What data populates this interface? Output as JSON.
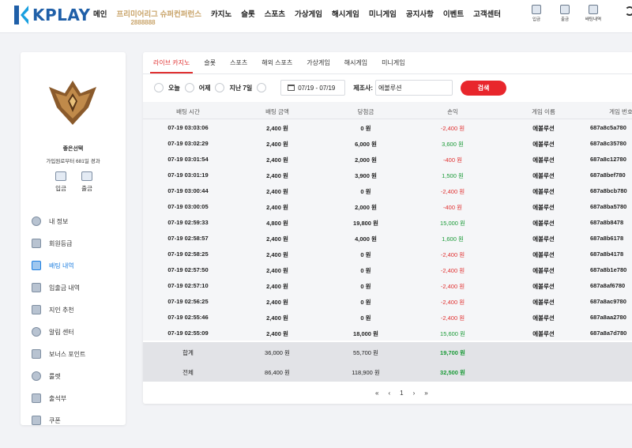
{
  "header": {
    "logo_text": "KPLAY",
    "nav": [
      "메인",
      "프리미어리그 슈퍼컨퍼런스",
      "카지노",
      "슬롯",
      "스포츠",
      "가상게임",
      "해시게임",
      "미니게임",
      "공지사항",
      "이벤트",
      "고객센터"
    ],
    "promo_sub": "2888888",
    "icons": [
      {
        "label": "입금",
        "icon": "deposit-icon"
      },
      {
        "label": "출금",
        "icon": "withdraw-icon"
      },
      {
        "label": "배팅내역",
        "icon": "history-icon"
      }
    ]
  },
  "sidebar": {
    "user_name": "좋은선택",
    "user_sub": "가입원로부터 681일 경과",
    "btn_deposit": "입금",
    "btn_withdraw": "출금",
    "menu": [
      {
        "label": "내 정보",
        "icon": "user-icon",
        "active": false
      },
      {
        "label": "회원등급",
        "icon": "rank-icon",
        "active": false
      },
      {
        "label": "배팅 내역",
        "icon": "betting-history-icon",
        "active": true
      },
      {
        "label": "입출금 내역",
        "icon": "transaction-icon",
        "active": false
      },
      {
        "label": "지인 추천",
        "icon": "referral-icon",
        "active": false
      },
      {
        "label": "알림 센터",
        "icon": "notification-icon",
        "active": false
      },
      {
        "label": "보너스 포인트",
        "icon": "bonus-icon",
        "active": false
      },
      {
        "label": "룰렛",
        "icon": "roulette-icon",
        "active": false
      },
      {
        "label": "출석부",
        "icon": "attendance-icon",
        "active": false
      },
      {
        "label": "쿠폰",
        "icon": "coupon-icon",
        "active": false
      }
    ]
  },
  "main": {
    "tabs": [
      "라이브 카지노",
      "슬롯",
      "스포츠",
      "해외 스포츠",
      "가상게임",
      "해시게임",
      "미니게임"
    ],
    "filters": {
      "today": "오늘",
      "yesterday": "어제",
      "last7": "지난 7일",
      "date_range": "07/19 - 07/19",
      "maker_label": "제조사:",
      "maker_value": "에볼루션",
      "search_btn": "검색"
    },
    "columns": [
      "배팅 시간",
      "배팅 금액",
      "당첨금",
      "손익",
      "게임 이름",
      "게임 번호"
    ],
    "rows": [
      [
        "07-19 03:03:06",
        "2,400 원",
        "0 원",
        "-2,400 원",
        "에볼루션",
        "687a8c5a780"
      ],
      [
        "07-19 03:02:29",
        "2,400 원",
        "6,000 원",
        "3,600 원",
        "에볼루션",
        "687a8c35780"
      ],
      [
        "07-19 03:01:54",
        "2,400 원",
        "2,000 원",
        "-400 원",
        "에볼루션",
        "687a8c12780"
      ],
      [
        "07-19 03:01:19",
        "2,400 원",
        "3,900 원",
        "1,500 원",
        "에볼루션",
        "687a8bef780"
      ],
      [
        "07-19 03:00:44",
        "2,400 원",
        "0 원",
        "-2,400 원",
        "에볼루션",
        "687a8bcb780"
      ],
      [
        "07-19 03:00:05",
        "2,400 원",
        "2,000 원",
        "-400 원",
        "에볼루션",
        "687a8ba5780"
      ],
      [
        "07-19 02:59:33",
        "4,800 원",
        "19,800 원",
        "15,000 원",
        "에볼루션",
        "687a8b8478"
      ],
      [
        "07-19 02:58:57",
        "2,400 원",
        "4,000 원",
        "1,600 원",
        "에볼루션",
        "687a8b6178"
      ],
      [
        "07-19 02:58:25",
        "2,400 원",
        "0 원",
        "-2,400 원",
        "에볼루션",
        "687a8b4178"
      ],
      [
        "07-19 02:57:50",
        "2,400 원",
        "0 원",
        "-2,400 원",
        "에볼루션",
        "687a8b1e780"
      ],
      [
        "07-19 02:57:10",
        "2,400 원",
        "0 원",
        "-2,400 원",
        "에볼루션",
        "687a8af6780"
      ],
      [
        "07-19 02:56:25",
        "2,400 원",
        "0 원",
        "-2,400 원",
        "에볼루션",
        "687a8ac9780"
      ],
      [
        "07-19 02:55:46",
        "2,400 원",
        "0 원",
        "-2,400 원",
        "에볼루션",
        "687a8aa2780"
      ],
      [
        "07-19 02:55:09",
        "2,400 원",
        "18,000 원",
        "15,600 원",
        "에볼루션",
        "687a8a7d780"
      ]
    ],
    "summary": [
      [
        "합계",
        "36,000 원",
        "55,700 원",
        "19,700 원"
      ],
      [
        "전체",
        "86,400 원",
        "118,900 원",
        "32,500 원"
      ]
    ],
    "pager": [
      "«",
      "‹",
      "1",
      "›",
      "»"
    ]
  },
  "colors": {
    "accent": "#e8262c",
    "positive": "#1a9a37",
    "negative": "#e03131",
    "active_menu": "#1f7fe0",
    "brand": "#1f5fa8"
  }
}
